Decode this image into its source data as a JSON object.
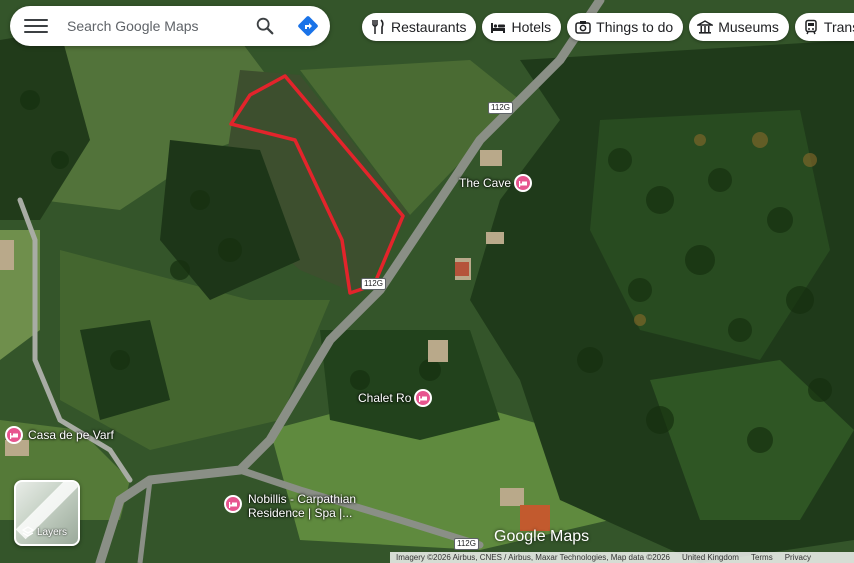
{
  "search": {
    "placeholder": "Search Google Maps"
  },
  "chips": [
    {
      "label": "Restaurants",
      "icon": "fork-knife-icon"
    },
    {
      "label": "Hotels",
      "icon": "bed-icon"
    },
    {
      "label": "Things to do",
      "icon": "camera-icon"
    },
    {
      "label": "Museums",
      "icon": "museum-icon"
    },
    {
      "label": "Transport",
      "icon": "train-icon"
    }
  ],
  "places": [
    {
      "name": "The Cave",
      "icon": "hotel-pin-icon"
    },
    {
      "name": "Chalet Ro",
      "icon": "hotel-pin-icon"
    },
    {
      "name": "Casa de pe Varf",
      "icon": "hotel-pin-icon"
    },
    {
      "name": "Nobillis - Carpathian Residence | Spa |...",
      "line1": "Nobillis - Carpathian",
      "line2": "Residence | Spa |...",
      "icon": "hotel-pin-icon"
    }
  ],
  "roads": {
    "shield_label": "112G"
  },
  "layers": {
    "label": "Layers"
  },
  "watermark": "Google Maps",
  "footer": {
    "imagery": "Imagery ©2026 Airbus, CNES / Airbus, Maxar Technologies, Map data ©2026",
    "region": "United Kingdom",
    "terms": "Terms",
    "privacy": "Privacy"
  },
  "colors": {
    "pin": "#e7558f",
    "boundary": "#e3242b",
    "road": "#8a8f86",
    "directions": "#1a73e8"
  }
}
